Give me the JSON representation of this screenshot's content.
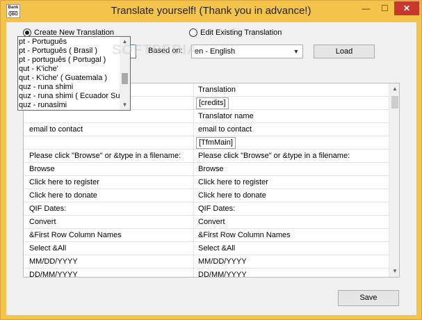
{
  "window": {
    "title": "Translate yourself! (Thank you in advance!)",
    "icon_text_top": "Bank",
    "icon_text_bottom": "QBO",
    "controls": {
      "minimize": "—",
      "maximize": "☐",
      "close": "✕"
    }
  },
  "options": {
    "create_new_label": "Create New Translation",
    "edit_existing_label": "Edit Existing Translation",
    "selected": "create_new"
  },
  "language_combo": {
    "value": ""
  },
  "based_on": {
    "label": "Based on:",
    "value": "en - English"
  },
  "buttons": {
    "load": "Load",
    "save": "Save"
  },
  "dropdown_items": [
    "pt - Português",
    "pt - Português ( Brasil )",
    "pt - português ( Portugal )",
    "qut - K'iche'",
    "qut - K'iche' ( Guatemala )",
    "quz - runa shimi",
    "quz - runa shimi ( Ecuador Suyu )",
    "quz - runasimi"
  ],
  "watermark": "SOFTPEDIA",
  "grid": {
    "header_col2": "Translation",
    "rows": [
      {
        "c1": "",
        "c2": "[credits]"
      },
      {
        "c1": "",
        "c2": "Translator name"
      },
      {
        "c1": "email to contact",
        "c2": "email to contact"
      },
      {
        "c1": "",
        "c2": "[TfmMain]"
      },
      {
        "c1": "Please click \"Browse\" or &type in a filename:",
        "c2": "Please click \"Browse\" or &type in a filename:"
      },
      {
        "c1": "Browse",
        "c2": "Browse"
      },
      {
        "c1": "Click here to register",
        "c2": "Click here to register"
      },
      {
        "c1": "Click here to donate",
        "c2": "Click here to donate"
      },
      {
        "c1": "QIF Dates:",
        "c2": "QIF Dates:"
      },
      {
        "c1": "Convert",
        "c2": "Convert"
      },
      {
        "c1": "&First Row Column Names",
        "c2": "&First Row Column Names"
      },
      {
        "c1": "Select &All",
        "c2": "Select &All"
      },
      {
        "c1": "MM/DD/YYYY",
        "c2": "MM/DD/YYYY"
      },
      {
        "c1": "DD/MM/YYYY",
        "c2": "DD/MM/YYYY"
      }
    ]
  }
}
